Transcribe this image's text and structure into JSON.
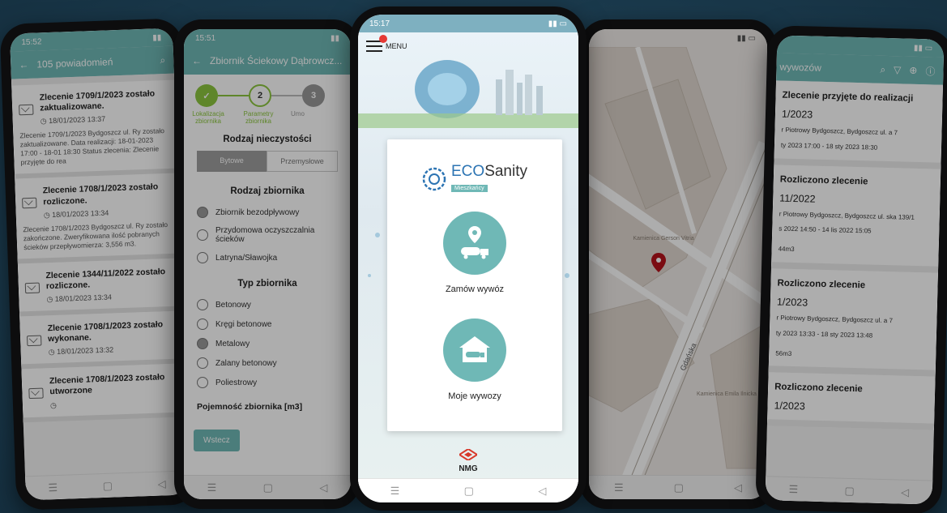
{
  "phone1": {
    "time": "15:52",
    "appbar_title": "105 powiadomień",
    "notifications": [
      {
        "title": "Zlecenie 1709/1/2023 zostało zaktualizowane.",
        "date": "18/01/2023 13:37",
        "body": "Zlecenie 1709/1/2023 Bydgoszcz ul. Ry zostało zaktualizowane. Data realizacji: 18-01-2023 17:00 - 18-01 18:30 Status zlecenia: Zlecenie przyjęte do rea"
      },
      {
        "title": "Zlecenie 1708/1/2023 zostało rozliczone.",
        "date": "18/01/2023 13:34",
        "body": "Zlecenie 1708/1/2023 Bydgoszcz ul. Ry zostało zakończone. Zweryfikowana ilość pobranych ścieków przepływomierza: 3,556 m3."
      },
      {
        "title": "Zlecenie 1344/11/2022 zostało rozliczone.",
        "date": "18/01/2023 13:34",
        "body": ""
      },
      {
        "title": "Zlecenie 1708/1/2023 zostało wykonane.",
        "date": "18/01/2023 13:32",
        "body": ""
      },
      {
        "title": "Zlecenie 1708/1/2023 zostało utworzone",
        "date": "",
        "body": ""
      }
    ]
  },
  "phone2": {
    "time": "15:51",
    "appbar_title": "Zbiornik Ściekowy Dąbrowcz...",
    "steps": [
      {
        "label": "Lokalizacja zbiornika",
        "num": "✓"
      },
      {
        "label": "Parametry zbiornika",
        "num": "2"
      },
      {
        "label": "Umo",
        "num": "3"
      }
    ],
    "section_impurity": "Rodzaj nieczystości",
    "impurity_options": [
      "Bytowe",
      "Przemysłowe"
    ],
    "section_tank": "Rodzaj zbiornika",
    "tank_options": [
      {
        "label": "Zbiornik bezodpływowy",
        "checked": true
      },
      {
        "label": "Przydomowa oczyszczalnia ścieków",
        "checked": false
      },
      {
        "label": "Latryna/Sławojka",
        "checked": false
      }
    ],
    "section_type": "Typ zbiornika",
    "type_options": [
      {
        "label": "Betonowy",
        "checked": false
      },
      {
        "label": "Kręgi betonowe",
        "checked": false
      },
      {
        "label": "Metalowy",
        "checked": true
      },
      {
        "label": "Zalany betonowy",
        "checked": false
      },
      {
        "label": "Poliestrowy",
        "checked": false
      }
    ],
    "section_capacity": "Pojemność zbiornika [m3]",
    "next_button": "Wstecz"
  },
  "phone3": {
    "time": "15:17",
    "menu_label": "MENU",
    "brand_eco": "ECO",
    "brand_sanity": "Sanity",
    "brand_sub": "Mieszkańcy",
    "order_label": "Zamów wywóz",
    "my_label": "Moje wywozy",
    "footer_logo": "NMG"
  },
  "phone4": {
    "street_label": "Gdańska",
    "poi_1": "Kamienica Gerson Vitria",
    "poi_2": "Kamienica Emila Ilnicka",
    "pin_color": "#b5121b"
  },
  "phone5": {
    "appbar_title": "wywozów",
    "orders": [
      {
        "title": "Zlecenie przyjęte do realizacji",
        "num": "1/2023",
        "addr": "r Piotrowy Bydgoszcz, Bydgoszcz ul. a 7",
        "time": "ty 2023 17:00 - 18 sty 2023 18:30",
        "qty": ""
      },
      {
        "title": "Rozliczono zlecenie",
        "num": "11/2022",
        "addr": "r Piotrowy Bydgoszcz, Bydgoszcz ul. ska 139/1",
        "time": "s 2022 14:50 - 14 lis 2022 15:05",
        "qty": "44m3"
      },
      {
        "title": "Rozliczono zlecenie",
        "num": "1/2023",
        "addr": "r Piotrowy Bydgoszcz, Bydgoszcz ul. a 7",
        "time": "ty 2023 13:33 - 18 sty 2023 13:48",
        "qty": "56m3"
      },
      {
        "title": "Rozliczono zlecenie",
        "num": "1/2023",
        "addr": "",
        "time": "",
        "qty": ""
      }
    ]
  },
  "colors": {
    "teal": "#6fb8b6",
    "green": "#8cc63f",
    "brand_blue": "#2c74b3"
  }
}
